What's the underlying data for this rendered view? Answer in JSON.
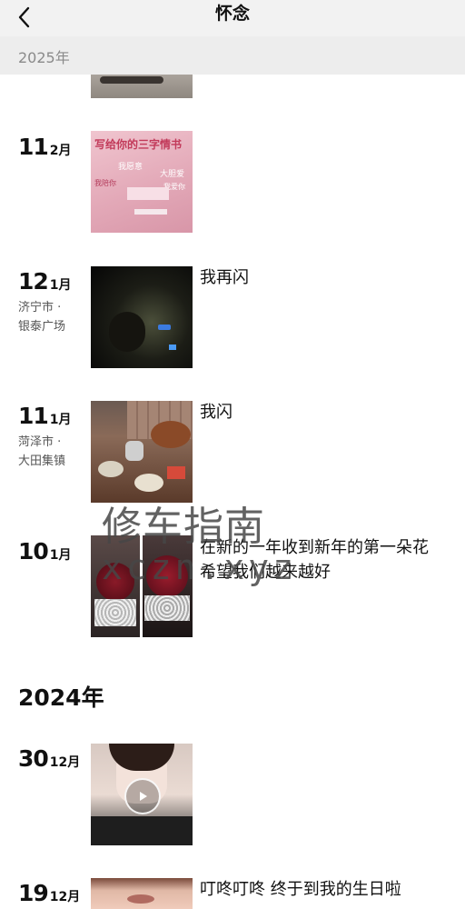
{
  "nav": {
    "title": "怀念"
  },
  "sticky_year": "2025年",
  "entries": [
    {
      "day": "11",
      "month": "2月",
      "location": [],
      "caption": ""
    },
    {
      "day": "12",
      "month": "1月",
      "location": [
        "济宁市 ·",
        "银泰广场"
      ],
      "caption": "我再闪"
    },
    {
      "day": "11",
      "month": "1月",
      "location": [
        "菏泽市 ·",
        "大田集镇"
      ],
      "caption": "我闪"
    },
    {
      "day": "10",
      "month": "1月",
      "location": [],
      "caption": "在新的一年收到新年的第一朵花 希望我们越来越好"
    },
    {
      "day": "30",
      "month": "12月",
      "location": [],
      "caption": ""
    },
    {
      "day": "19",
      "month": "12月",
      "location": [],
      "caption": "叮咚叮咚  终于到我的生日啦"
    }
  ],
  "year_2024": "2024年",
  "card_text": {
    "title": "写给你的三字情书",
    "lines": [
      "我愿意",
      "大胆爱",
      "我陪你",
      "我爱你"
    ]
  },
  "watermark": {
    "line1": "修车指南",
    "line2": "xczn.xyz"
  },
  "colors": {
    "nav_bg": "#f2f2f2",
    "year_bar_bg": "#ededed",
    "card_pink": "#e8a6b8"
  }
}
